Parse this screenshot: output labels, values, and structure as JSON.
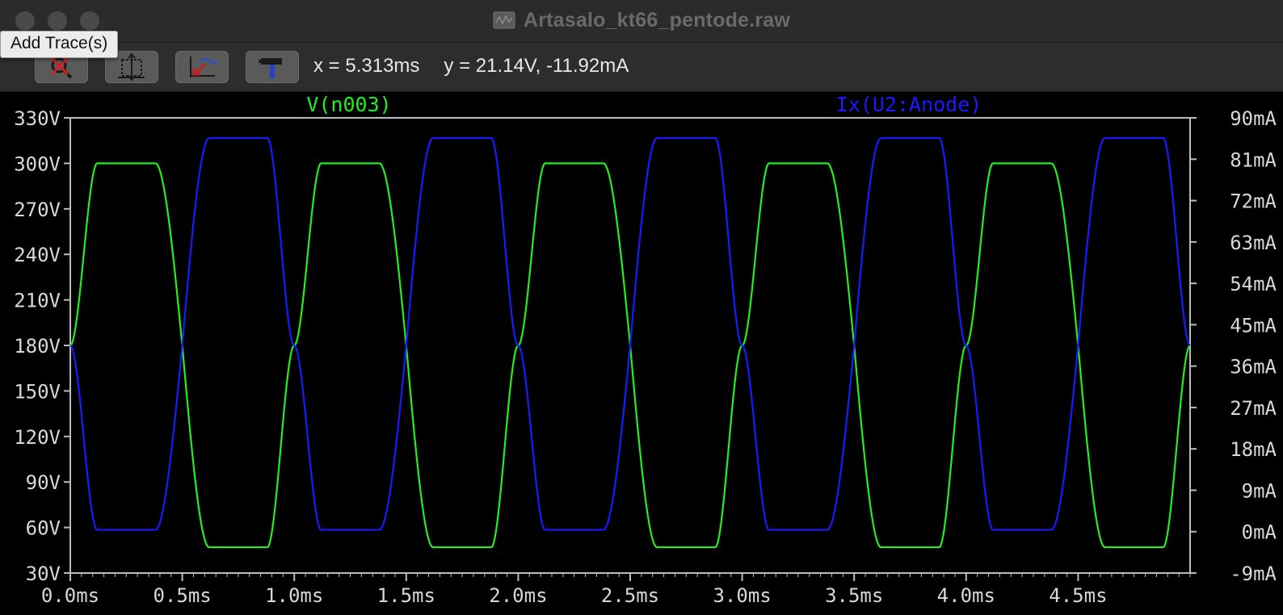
{
  "window": {
    "title": "Artasalo_kt66_pentode.raw"
  },
  "tooltip": {
    "text": "Add Trace(s)"
  },
  "toolbar": {
    "buttons": [
      {
        "name": "zoom-off-button",
        "icon": "magnifier-cross-icon"
      },
      {
        "name": "autorange-button",
        "icon": "axis-autorange-icon"
      },
      {
        "name": "pan-zoom-back-button",
        "icon": "zoom-back-icon"
      },
      {
        "name": "hammer-button",
        "icon": "hammer-icon"
      }
    ],
    "cursor_x": "x = 5.313ms",
    "cursor_y": "y = 21.14V, -11.92mA"
  },
  "colors": {
    "green_trace": "#22ee22",
    "blue_trace": "#1a1aff",
    "axis": "#bcbcbc",
    "tick_text": "#d8d8d8",
    "background": "#000000"
  },
  "chart_data": {
    "type": "line",
    "x_unit": "ms",
    "xlim": [
      0,
      5.0
    ],
    "x_ticks": [
      "0.0ms",
      "0.5ms",
      "1.0ms",
      "1.5ms",
      "2.0ms",
      "2.5ms",
      "3.0ms",
      "3.5ms",
      "4.0ms",
      "4.5ms"
    ],
    "x_tick_values": [
      0,
      0.5,
      1.0,
      1.5,
      2.0,
      2.5,
      3.0,
      3.5,
      4.0,
      4.5
    ],
    "y_left": {
      "lim": [
        30,
        330
      ],
      "ticks": [
        "330V",
        "300V",
        "270V",
        "240V",
        "210V",
        "180V",
        "150V",
        "120V",
        "90V",
        "60V",
        "30V"
      ],
      "tick_values": [
        330,
        300,
        270,
        240,
        210,
        180,
        150,
        120,
        90,
        60,
        30
      ]
    },
    "y_right": {
      "lim": [
        -9,
        90
      ],
      "ticks": [
        "90mA",
        "81mA",
        "72mA",
        "63mA",
        "54mA",
        "45mA",
        "36mA",
        "27mA",
        "18mA",
        "9mA",
        "0mA",
        "-9mA"
      ],
      "tick_values": [
        90,
        81,
        72,
        63,
        54,
        45,
        36,
        27,
        18,
        9,
        0,
        -9
      ]
    },
    "series": [
      {
        "name": "V(n003)",
        "axis": "left",
        "color": "#22ee22",
        "period_ms": 1.0,
        "center": 180,
        "high": 300,
        "low": 47,
        "phase": "rising-at-0"
      },
      {
        "name": "Ix(U2:Anode)",
        "axis": "right",
        "color": "#1a1aff",
        "period_ms": 1.0,
        "center": 40.5,
        "high": 85.6,
        "low": 0.4,
        "phase": "falling-at-0"
      }
    ]
  }
}
